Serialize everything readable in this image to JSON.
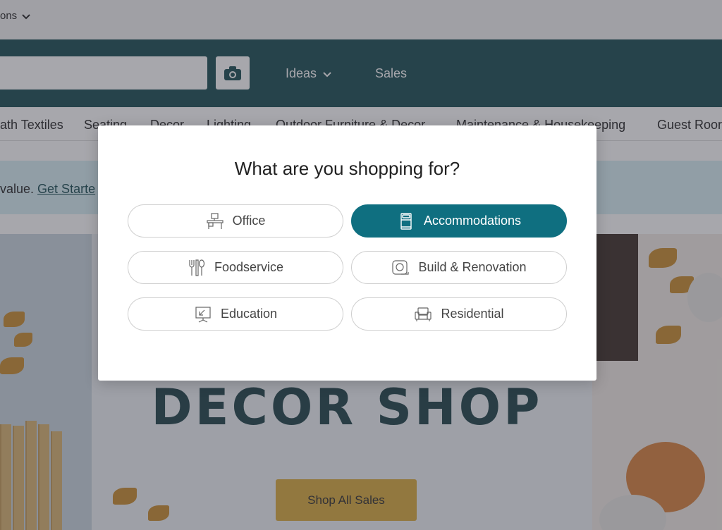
{
  "topbar": {
    "account_label": "ons"
  },
  "header": {
    "nav": [
      {
        "label": "Ideas"
      },
      {
        "label": "Sales"
      }
    ]
  },
  "categories": [
    "ath Textiles",
    "Seating",
    "Decor",
    "Lighting",
    "Outdoor Furniture & Decor",
    "Maintenance & Housekeeping",
    "Guest Roor"
  ],
  "promo": {
    "text": "value. ",
    "link": "Get Starte"
  },
  "hero": {
    "title": "DECOR SHOP",
    "button": "Shop All Sales"
  },
  "modal": {
    "title": "What are you shopping for?",
    "options": [
      {
        "label": "Office",
        "icon": "desk-icon",
        "selected": false
      },
      {
        "label": "Accommodations",
        "icon": "bed-icon",
        "selected": true
      },
      {
        "label": "Foodservice",
        "icon": "utensils-icon",
        "selected": false
      },
      {
        "label": "Build & Renovation",
        "icon": "tape-measure-icon",
        "selected": false
      },
      {
        "label": "Education",
        "icon": "whiteboard-icon",
        "selected": false
      },
      {
        "label": "Residential",
        "icon": "armchair-icon",
        "selected": false
      }
    ]
  },
  "colors": {
    "brand_teal": "#15494f",
    "selected_option": "#0f6f80",
    "cta_yellow": "#d9a93a"
  }
}
